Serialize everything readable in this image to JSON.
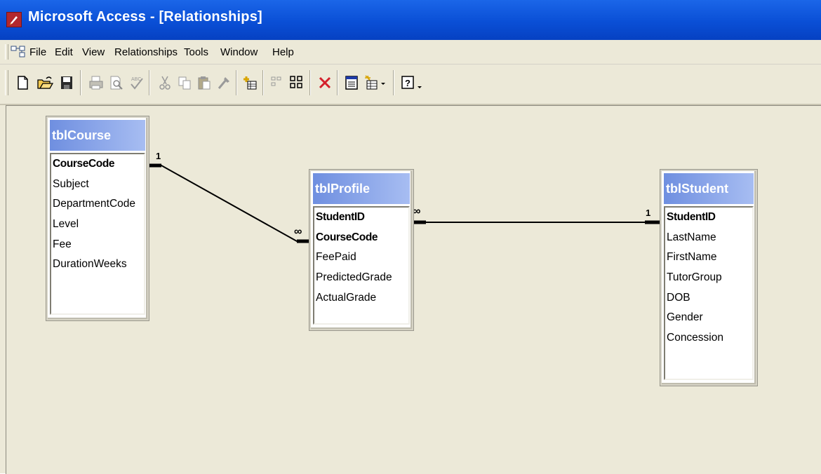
{
  "window": {
    "title": "Microsoft Access - [Relationships]"
  },
  "menu": [
    "File",
    "Edit",
    "View",
    "Relationships",
    "Tools",
    "Window",
    "Help"
  ],
  "toolbar": {
    "buttons": [
      "new-icon",
      "open-icon",
      "save-icon",
      "print-icon",
      "print-preview-icon",
      "spelling-icon",
      "cut-icon",
      "copy-icon",
      "paste-icon",
      "format-painter-icon",
      "show-table-icon",
      "show-direct-icon",
      "show-all-icon",
      "delete-icon",
      "properties-icon",
      "new-object-icon",
      "help-icon"
    ]
  },
  "tables": {
    "course": {
      "name": "tblCourse",
      "fields": [
        {
          "name": "CourseCode",
          "key": true
        },
        {
          "name": "Subject",
          "key": false
        },
        {
          "name": "DepartmentCode",
          "key": false
        },
        {
          "name": "Level",
          "key": false
        },
        {
          "name": "Fee",
          "key": false
        },
        {
          "name": "DurationWeeks",
          "key": false
        }
      ]
    },
    "profile": {
      "name": "tblProfile",
      "fields": [
        {
          "name": "StudentID",
          "key": true
        },
        {
          "name": "CourseCode",
          "key": true
        },
        {
          "name": "FeePaid",
          "key": false
        },
        {
          "name": "PredictedGrade",
          "key": false
        },
        {
          "name": "ActualGrade",
          "key": false
        }
      ]
    },
    "student": {
      "name": "tblStudent",
      "fields": [
        {
          "name": "StudentID",
          "key": true
        },
        {
          "name": "LastName",
          "key": false
        },
        {
          "name": "FirstName",
          "key": false
        },
        {
          "name": "TutorGroup",
          "key": false
        },
        {
          "name": "DOB",
          "key": false
        },
        {
          "name": "Gender",
          "key": false
        },
        {
          "name": "Concession",
          "key": false
        }
      ]
    }
  },
  "relationships": [
    {
      "from": "tblCourse.CourseCode",
      "to": "tblProfile.CourseCode",
      "one_label": "1",
      "many_label": "∞"
    },
    {
      "from": "tblStudent.StudentID",
      "to": "tblProfile.StudentID",
      "one_label": "1",
      "many_label": "∞"
    }
  ]
}
